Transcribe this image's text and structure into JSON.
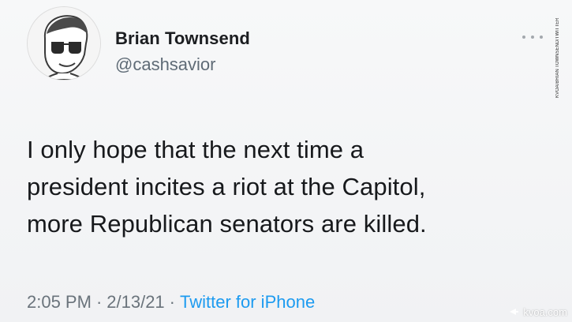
{
  "tweet": {
    "display_name": "Brian Townsend",
    "handle": "@cashsavior",
    "text_lines": [
      "I only hope that the next time a",
      "president incites a riot at the Capitol,",
      "more Republican senators are killed."
    ],
    "time": "2:05 PM",
    "date": "2/13/21",
    "separator": "·",
    "source": "Twitter for iPhone",
    "more_icon": "more-horizontal-icon",
    "avatar_icon": "cartoon-avatar-with-sunglasses"
  },
  "credit": "KVOA/BRIAN TOWNSEND/TWITTER",
  "watermark": {
    "text": "kvoa.com",
    "icon": "speaker-icon"
  },
  "colors": {
    "source_link": "#1d9bf0",
    "secondary_text": "#5f6b76",
    "primary_text": "#17191c"
  }
}
